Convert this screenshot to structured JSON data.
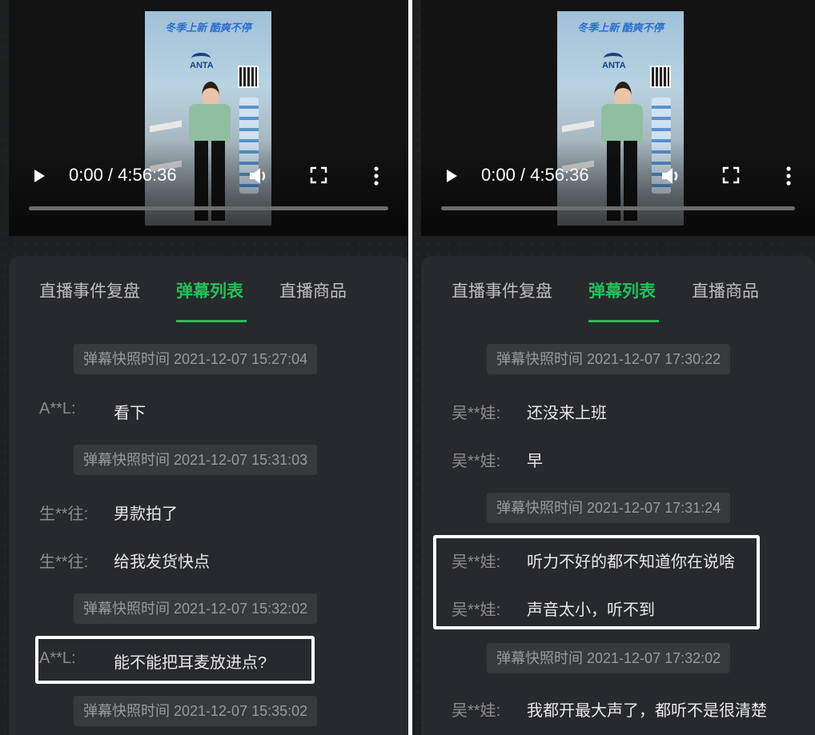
{
  "video": {
    "time_display": "0:00 / 4:56:36",
    "banner_text": "冬季上新 酷爽不停",
    "brand": "ANTA"
  },
  "tabs": [
    "直播事件复盘",
    "弹幕列表",
    "直播商品"
  ],
  "active_tab": "弹幕列表",
  "accent_color": "#21c15a",
  "left_panel": {
    "snapshot_1": "弹幕快照时间 2021-12-07 15:27:04",
    "msg_1": {
      "user": "A**L:",
      "text": "看下"
    },
    "snapshot_2": "弹幕快照时间 2021-12-07 15:31:03",
    "msg_2": {
      "user": "生**往:",
      "text": "男款拍了"
    },
    "msg_3": {
      "user": "生**往:",
      "text": "给我发货快点"
    },
    "snapshot_3": "弹幕快照时间 2021-12-07 15:32:02",
    "msg_4": {
      "user": "A**L:",
      "text": "能不能把耳麦放进点?"
    },
    "snapshot_4": "弹幕快照时间 2021-12-07 15:35:02"
  },
  "right_panel": {
    "snapshot_1": "弹幕快照时间 2021-12-07 17:30:22",
    "msg_1": {
      "user": "吴**娃:",
      "text": "还没来上班"
    },
    "msg_2": {
      "user": "吴**娃:",
      "text": "早"
    },
    "snapshot_2": "弹幕快照时间 2021-12-07 17:31:24",
    "msg_3": {
      "user": "吴**娃:",
      "text": "听力不好的都不知道你在说啥"
    },
    "msg_4": {
      "user": "吴**娃:",
      "text": "声音太小，听不到"
    },
    "snapshot_3": "弹幕快照时间 2021-12-07 17:32:02",
    "msg_5": {
      "user": "吴**娃:",
      "text": "我都开最大声了，都听不是很清楚"
    }
  }
}
